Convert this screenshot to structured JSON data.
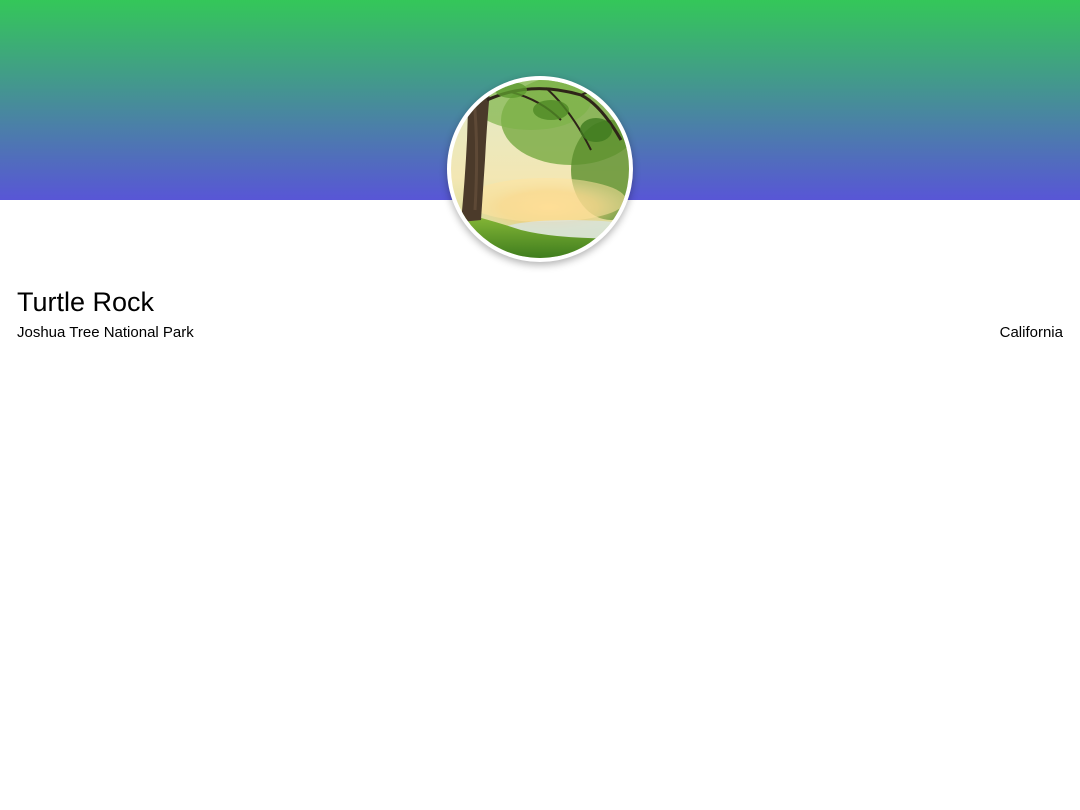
{
  "landmark": {
    "name": "Turtle Rock",
    "park": "Joshua Tree National Park",
    "state": "California",
    "photo_description_icon": "landscape-photo-icon"
  },
  "colors": {
    "banner_top": "#34c759",
    "banner_bottom": "#5856d6",
    "background": "#ffffff",
    "text": "#000000"
  }
}
